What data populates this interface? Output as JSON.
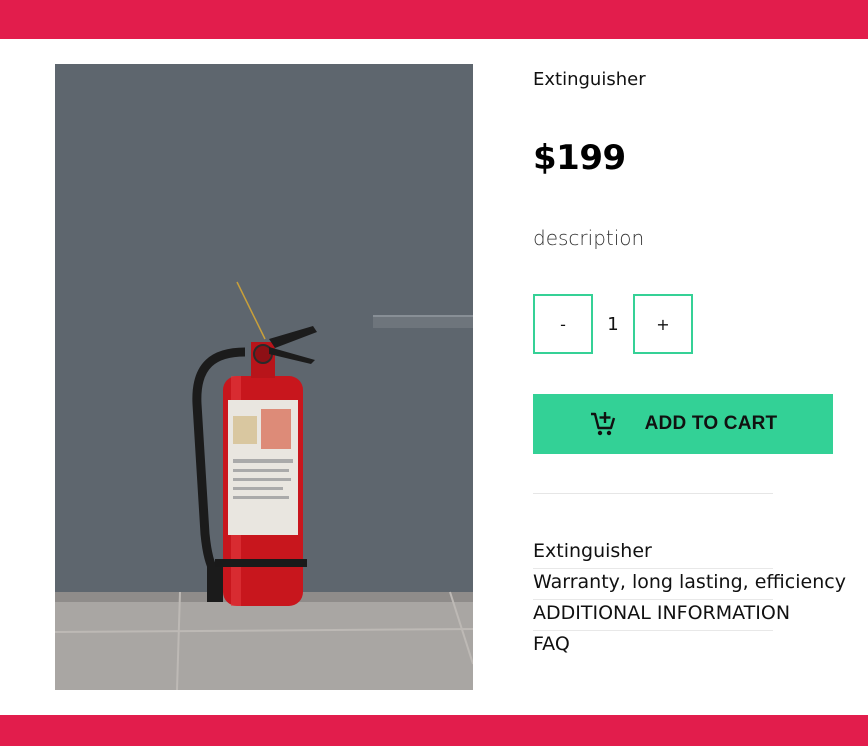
{
  "header": {
    "color": "#e21d4c"
  },
  "footer": {
    "color": "#e21d4c"
  },
  "product": {
    "name": "Extinguisher",
    "price": "$199",
    "description": "description",
    "image_alt": "red fire extinguisher",
    "quantity": {
      "minus_label": "-",
      "value": "1",
      "plus_label": "+"
    },
    "add_to_cart": {
      "label": "ADD TO CART",
      "icon": "cart-plus-icon",
      "color": "#33d196"
    },
    "meta": [
      {
        "label": "Extinguisher"
      },
      {
        "label": "Warranty, long lasting, efficiency"
      },
      {
        "label": "ADDITIONAL INFORMATION"
      },
      {
        "label": "FAQ"
      }
    ]
  }
}
